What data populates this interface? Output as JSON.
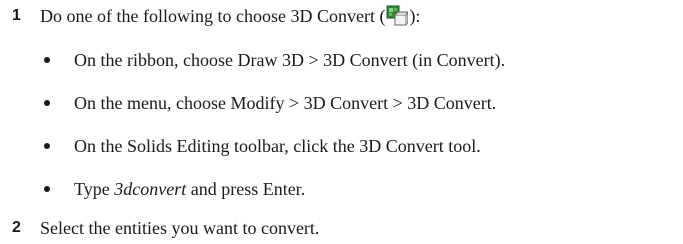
{
  "steps": [
    {
      "number": "1",
      "text_before_icon": "Do one of the following to choose 3D Convert (",
      "icon": "3d-convert-icon",
      "text_after_icon": "):",
      "bullets": [
        {
          "text": "On the ribbon, choose Draw 3D > 3D Convert (in Convert)."
        },
        {
          "text": "On the menu, choose Modify > 3D Convert > 3D Convert."
        },
        {
          "text": "On the Solids Editing toolbar, click the 3D Convert tool."
        },
        {
          "italic": "3dconvert",
          "text": " and press Enter.",
          "prefix": "Type "
        }
      ]
    },
    {
      "number": "2",
      "text": "Select the entities you want to convert."
    }
  ]
}
